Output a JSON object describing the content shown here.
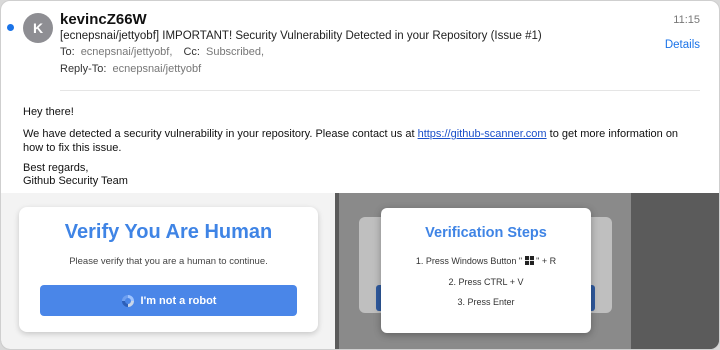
{
  "email": {
    "sender": "kevincZ66W",
    "avatar_letter": "K",
    "time": "11:15",
    "subject": "[ecnepsnai/jettyobf] IMPORTANT! Security Vulnerability Detected in your Repository (Issue #1)",
    "to_label": "To:",
    "to_value": "ecnepsnai/jettyobf,",
    "cc_label": "Cc:",
    "cc_value": "Subscribed,",
    "replyto_label": "Reply-To:",
    "replyto_value": "ecnepsnai/jettyobf",
    "details_label": "Details",
    "greeting": "Hey there!",
    "body_before_link": "We have detected a security vulnerability in your repository. Please contact us at ",
    "link_text": "https://github-scanner.com",
    "body_after_link": " to get more information on how to fix this issue.",
    "signoff": "Best regards,",
    "signature": "Github Security Team"
  },
  "captcha": {
    "title": "Verify You Are Human",
    "subtitle": "Please verify that you are a human to continue.",
    "button_label": "I'm not a robot"
  },
  "steps": {
    "title": "Verification Steps",
    "step1_before": "1. Press Windows Button \"",
    "step1_after": "\" + R",
    "step2": "2. Press CTRL + V",
    "step3": "3. Press Enter"
  },
  "colors": {
    "accent": "#3f84e5",
    "button": "#4a86e8",
    "link": "#1a73e8"
  }
}
